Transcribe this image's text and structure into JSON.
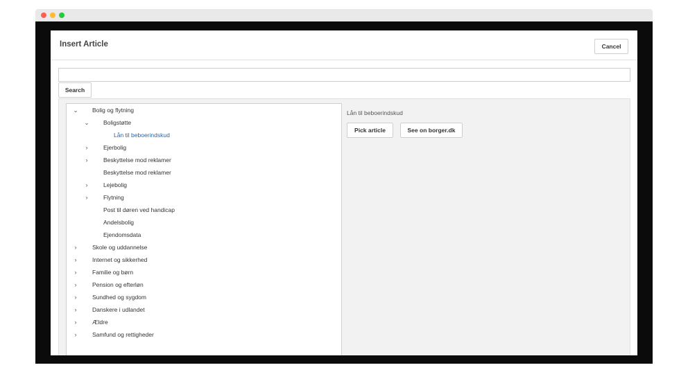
{
  "dialog": {
    "title": "Insert Article",
    "cancel_label": "Cancel"
  },
  "search": {
    "value": "",
    "placeholder": "",
    "button_label": "Search"
  },
  "tree": [
    {
      "label": "Bolig og flytning",
      "level": 0,
      "toggle": "expanded"
    },
    {
      "label": "Boligstøtte",
      "level": 1,
      "toggle": "expanded"
    },
    {
      "label": "Lån til beboerindskud",
      "level": 2,
      "toggle": "none",
      "selected": true
    },
    {
      "label": "Ejerbolig",
      "level": 1,
      "toggle": "collapsed"
    },
    {
      "label": "Beskyttelse mod reklamer",
      "level": 1,
      "toggle": "collapsed"
    },
    {
      "label": "Beskyttelse mod reklamer",
      "level": 1,
      "toggle": "none"
    },
    {
      "label": "Lejebolig",
      "level": 1,
      "toggle": "collapsed"
    },
    {
      "label": "Flytning",
      "level": 1,
      "toggle": "collapsed"
    },
    {
      "label": "Post til døren ved handicap",
      "level": 1,
      "toggle": "none"
    },
    {
      "label": "Andelsbolig",
      "level": 1,
      "toggle": "none"
    },
    {
      "label": "Ejendomsdata",
      "level": 1,
      "toggle": "none"
    },
    {
      "label": "Skole og uddannelse",
      "level": 0,
      "toggle": "collapsed"
    },
    {
      "label": "Internet og sikkerhed",
      "level": 0,
      "toggle": "collapsed"
    },
    {
      "label": "Familie og børn",
      "level": 0,
      "toggle": "collapsed"
    },
    {
      "label": "Pension og efterløn",
      "level": 0,
      "toggle": "collapsed"
    },
    {
      "label": "Sundhed og sygdom",
      "level": 0,
      "toggle": "collapsed"
    },
    {
      "label": "Danskere i udlandet",
      "level": 0,
      "toggle": "collapsed"
    },
    {
      "label": "Ældre",
      "level": 0,
      "toggle": "collapsed"
    },
    {
      "label": "Samfund og rettigheder",
      "level": 0,
      "toggle": "collapsed"
    }
  ],
  "preview": {
    "title": "Lån til beboerindskud",
    "pick_label": "Pick article",
    "borger_label": "See on borger.dk"
  },
  "colors": {
    "selected": "#2a64a8",
    "panel_bg": "#f2f2f2",
    "window_frame": "#0b0b0b"
  },
  "icons": {
    "expanded": "chevron-down-icon",
    "collapsed": "chevron-right-icon"
  }
}
